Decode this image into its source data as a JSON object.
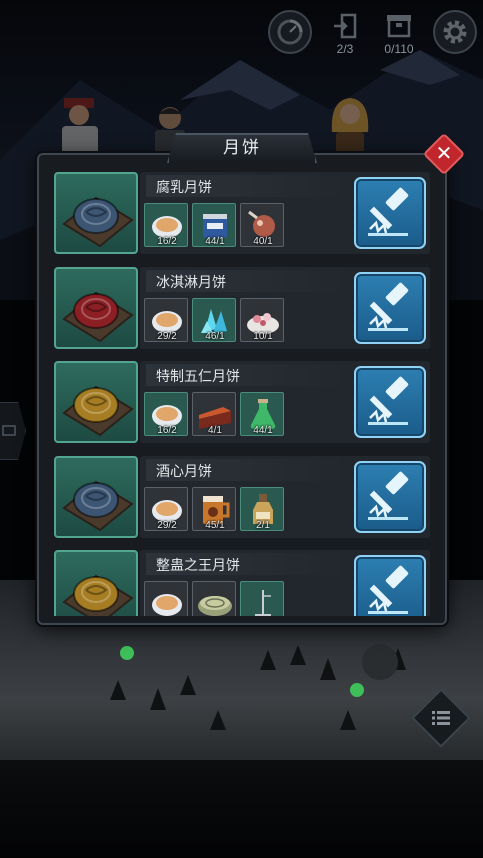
{
  "hud": {
    "dismantle_count": "2/3",
    "storage_count": "0/110"
  },
  "panel": {
    "title": "月饼"
  },
  "recipes": [
    {
      "name": "腐乳月饼",
      "cake_color": "#3b5573",
      "materials": [
        {
          "icon": "pancake-icon",
          "count": "16/2",
          "style": "green"
        },
        {
          "icon": "tin-can-icon",
          "count": "44/1",
          "style": "green"
        },
        {
          "icon": "meat-icon",
          "count": "40/1",
          "style": "dark"
        }
      ]
    },
    {
      "name": "冰淇淋月饼",
      "cake_color": "#8b1f24",
      "materials": [
        {
          "icon": "pancake-icon",
          "count": "29/2",
          "style": "dark"
        },
        {
          "icon": "ice-crystal-icon",
          "count": "46/1",
          "style": "green"
        },
        {
          "icon": "flower-plate-icon",
          "count": "10/1",
          "style": "dark"
        }
      ]
    },
    {
      "name": "特制五仁月饼",
      "cake_color": "#a67d22",
      "materials": [
        {
          "icon": "pancake-icon",
          "count": "16/2",
          "style": "green"
        },
        {
          "icon": "cake-slice-icon",
          "count": "4/1",
          "style": "dark"
        },
        {
          "icon": "potion-flask-icon",
          "count": "44/1",
          "style": "green"
        }
      ]
    },
    {
      "name": "酒心月饼",
      "cake_color": "#3b5573",
      "materials": [
        {
          "icon": "pancake-icon",
          "count": "29/2",
          "style": "dark"
        },
        {
          "icon": "beer-mug-icon",
          "count": "45/1",
          "style": "dark"
        },
        {
          "icon": "bottle-icon",
          "count": "2/1",
          "style": "green"
        }
      ]
    },
    {
      "name": "整蛊之王月饼",
      "cake_color": "#a67d22",
      "materials": [
        {
          "icon": "pancake-icon",
          "count": "",
          "style": "dark"
        },
        {
          "icon": "round-box-icon",
          "count": "",
          "style": "dark"
        },
        {
          "icon": "antenna-icon",
          "count": "",
          "style": "green"
        }
      ]
    }
  ],
  "icons": {
    "hud": [
      "timer-icon",
      "exit-door-icon",
      "storage-box-icon",
      "settings-gear-icon"
    ],
    "forge": "forge-hammer-icon",
    "close": "close-icon",
    "side": "chat-icon",
    "menu": "list-menu-icon"
  }
}
